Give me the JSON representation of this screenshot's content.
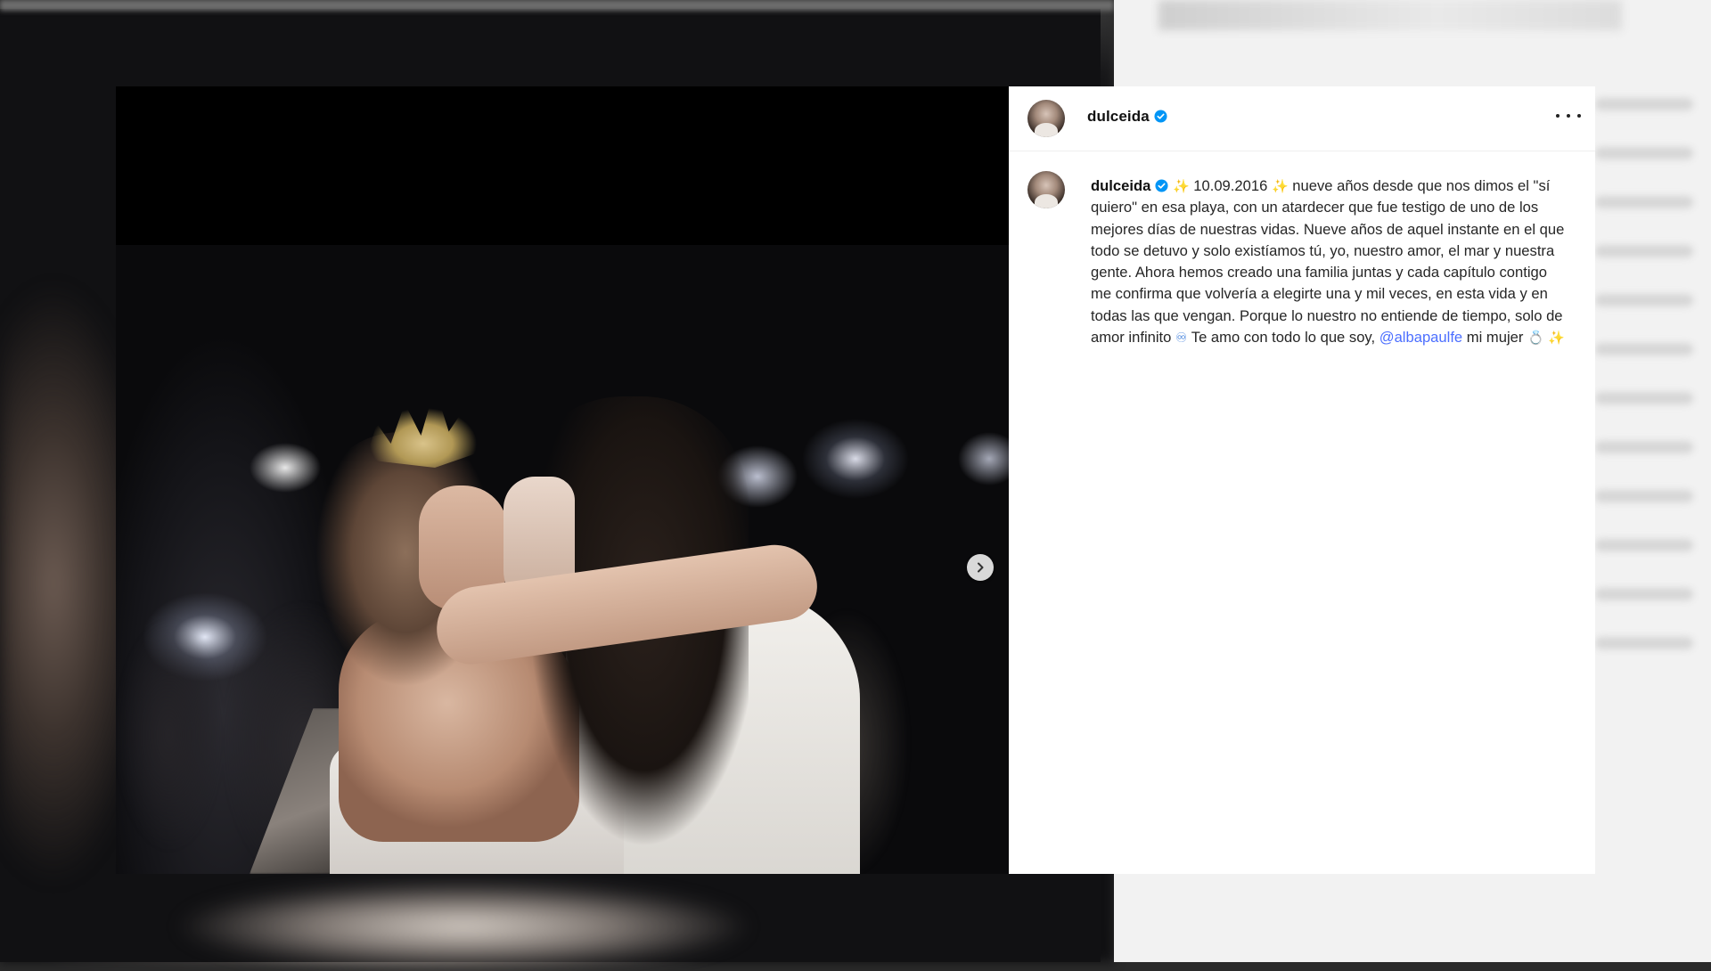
{
  "post": {
    "author": {
      "username": "dulceida",
      "verified": true
    },
    "media": {
      "next_button_icon": "chevron-right-icon"
    },
    "header": {
      "more_icon": "more-horizontal-icon"
    },
    "caption": {
      "username": "dulceida",
      "sparkle_1": "✨",
      "date": "10.09.2016",
      "sparkle_2": "✨",
      "text_main": "nueve años desde que nos dimos el \"sí quiero\" en esa playa, con un atardecer que fue testigo de uno de los mejores días de nuestras vidas. Nueve años de aquel instante en el que todo se detuvo y solo existíamos tú, yo, nuestro amor, el mar y nuestra gente. Ahora hemos creado una familia juntas y cada capítulo contigo me confirma que volvería a elegirte una y mil veces, en esta vida y en todas las que vengan. Porque lo nuestro no entiende de tiempo, solo de amor infinito",
      "infinity_emoji": "♾",
      "text_after": "Te amo con todo lo que soy,",
      "mention": "@albapaulfe",
      "text_end": "mi mujer",
      "ring_emoji": "💍",
      "sparkle_3": "✨"
    }
  },
  "colors": {
    "verified_blue": "#0095f6",
    "mention": "#4c6fff"
  }
}
